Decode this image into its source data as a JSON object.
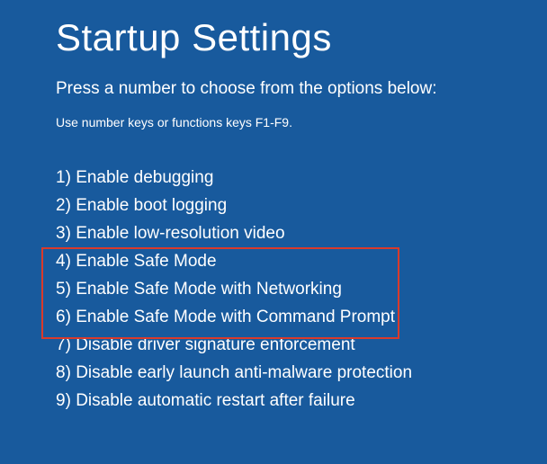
{
  "title": "Startup Settings",
  "instruction": "Press a number to choose from the options below:",
  "subinstruction": "Use number keys or functions keys F1-F9.",
  "options": [
    {
      "num": "1",
      "label": "Enable debugging"
    },
    {
      "num": "2",
      "label": "Enable boot logging"
    },
    {
      "num": "3",
      "label": "Enable low-resolution video"
    },
    {
      "num": "4",
      "label": "Enable Safe Mode"
    },
    {
      "num": "5",
      "label": "Enable Safe Mode with Networking"
    },
    {
      "num": "6",
      "label": "Enable Safe Mode with Command Prompt"
    },
    {
      "num": "7",
      "label": "Disable driver signature enforcement"
    },
    {
      "num": "8",
      "label": "Disable early launch anti-malware protection"
    },
    {
      "num": "9",
      "label": "Disable automatic restart after failure"
    }
  ],
  "highlighted_range": {
    "start": 4,
    "end": 6
  },
  "colors": {
    "background": "#185a9d",
    "text": "#ffffff",
    "highlight_border": "#d93a2b"
  }
}
